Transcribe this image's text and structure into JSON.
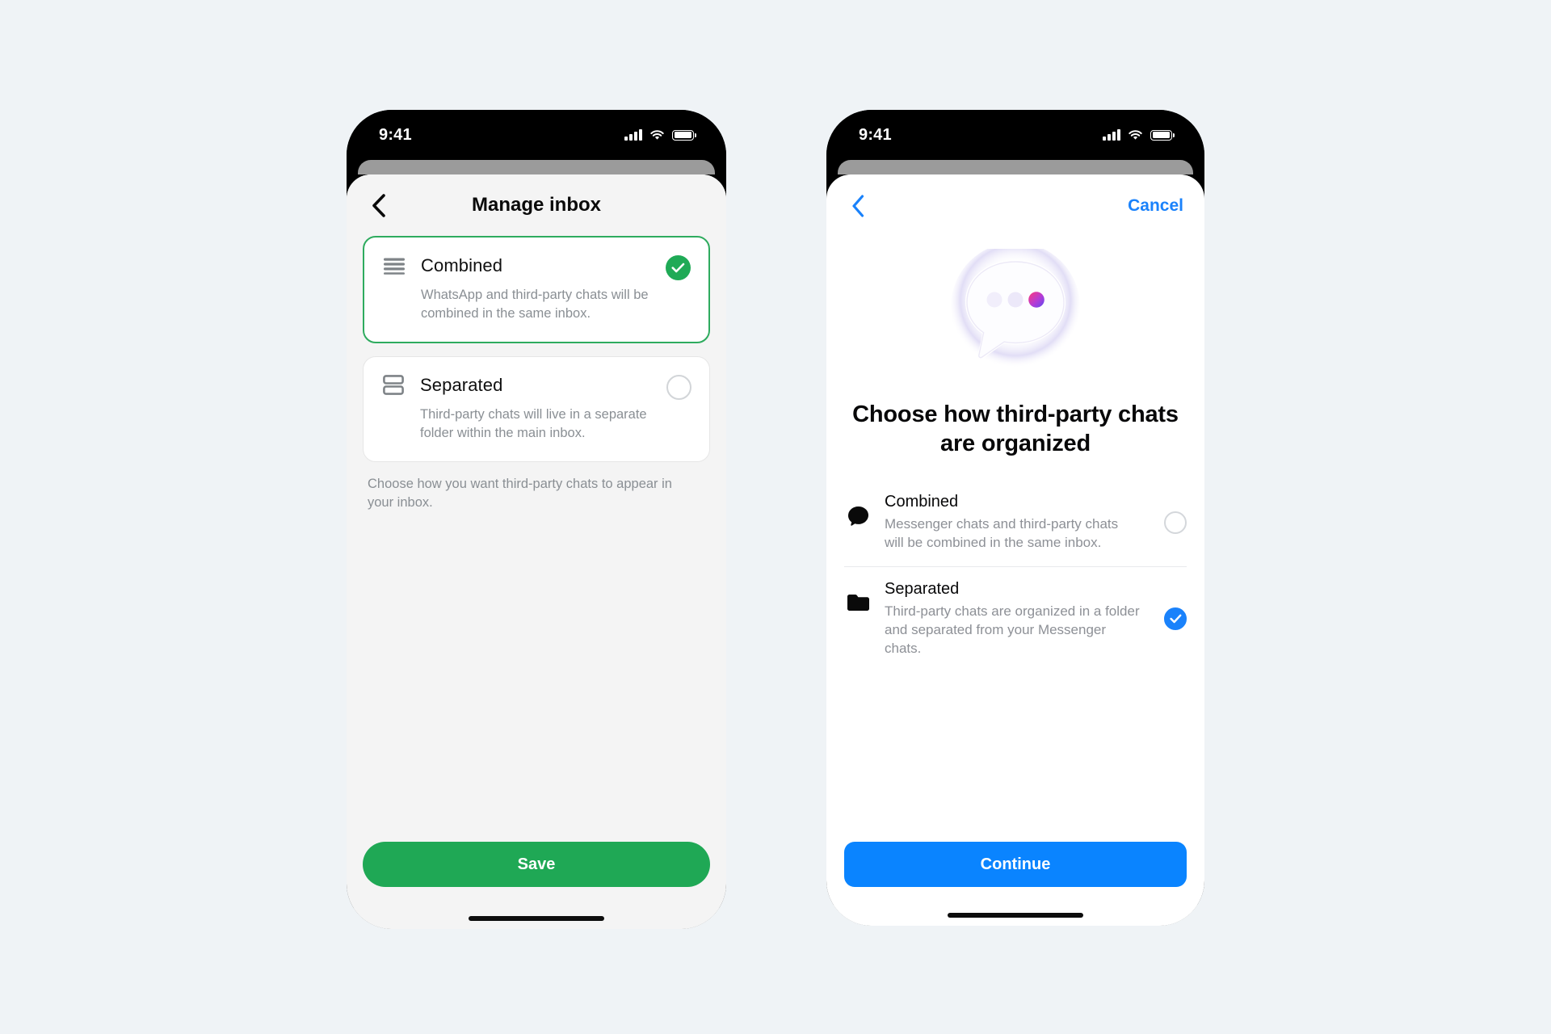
{
  "background_color": "#eff3f6",
  "phones": {
    "left": {
      "status_bar": {
        "time": "9:41",
        "signal_icon": "cellular-bars-icon",
        "wifi_icon": "wifi-icon",
        "battery_icon": "battery-icon"
      },
      "nav": {
        "back_icon": "chevron-left-icon",
        "title": "Manage inbox"
      },
      "accent_color": "#1fa855",
      "options": [
        {
          "icon": "list-lines-icon",
          "title": "Combined",
          "description": "WhatsApp and third-party chats will be combined in the same inbox.",
          "selected": true
        },
        {
          "icon": "stacked-rows-icon",
          "title": "Separated",
          "description": "Third-party chats will live in a separate folder within the main inbox.",
          "selected": false
        }
      ],
      "hint": "Choose how you want third-party chats to appear in your inbox.",
      "primary_button": "Save"
    },
    "right": {
      "status_bar": {
        "time": "9:41",
        "signal_icon": "cellular-bars-icon",
        "wifi_icon": "wifi-icon",
        "battery_icon": "battery-icon"
      },
      "nav": {
        "back_icon": "chevron-left-icon",
        "cancel_label": "Cancel"
      },
      "accent_color": "#0a84ff",
      "hero_icon": "speech-bubble-dots-illustration",
      "heading": "Choose how third-party chats are organized",
      "options": [
        {
          "icon": "chat-bubble-icon",
          "title": "Combined",
          "description": "Messenger chats and third-party chats will be combined in the same inbox.",
          "selected": false
        },
        {
          "icon": "folder-icon",
          "title": "Separated",
          "description": "Third-party chats are organized in a folder and separated from your Messenger chats.",
          "selected": true
        }
      ],
      "primary_button": "Continue"
    }
  }
}
